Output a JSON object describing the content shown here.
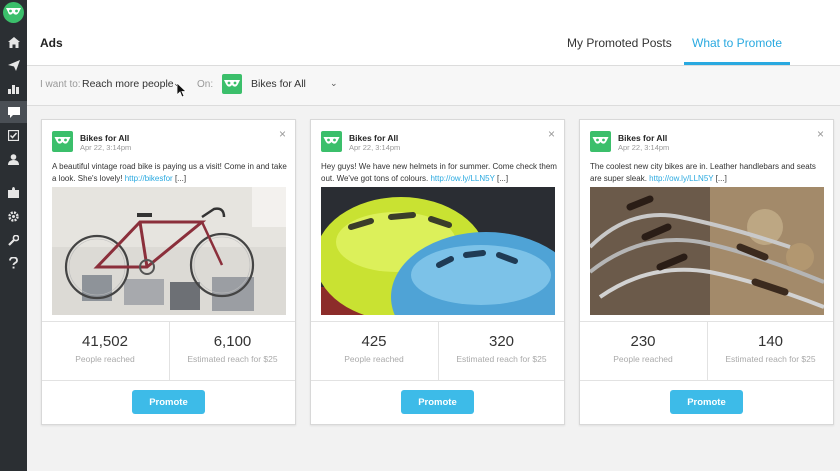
{
  "sidebar": {
    "items": [
      {
        "icon": "home-icon"
      },
      {
        "icon": "send-icon"
      },
      {
        "icon": "analytics-icon"
      },
      {
        "icon": "ads-icon"
      },
      {
        "icon": "assignments-icon"
      },
      {
        "icon": "contacts-icon"
      },
      {
        "icon": "apps-icon"
      },
      {
        "icon": "settings-icon"
      },
      {
        "icon": "tools-icon"
      },
      {
        "icon": "help-icon"
      }
    ]
  },
  "header": {
    "title": "Ads",
    "tabs": [
      {
        "label": "My Promoted Posts",
        "active": false
      },
      {
        "label": "What to Promote",
        "active": true
      }
    ]
  },
  "filter": {
    "goal_label": "I want to:",
    "goal_value": "Reach more people",
    "on_label": "On:",
    "profile_value": "Bikes for All"
  },
  "colors": {
    "accent": "#29a9e0",
    "button": "#3dbbe8",
    "brand_green": "#3bbf6b",
    "sidebar": "#2b2f33"
  },
  "cards": [
    {
      "author": "Bikes for All",
      "date": "Apr 22, 3:14pm",
      "text": "A beautiful vintage road bike is paying us a visit! Come in and take a look. She's lovely! ",
      "link": "http://bikesfor",
      "ellipsis": " [...]",
      "image": "vintage-road-bike-photo",
      "stat1_value": "41,502",
      "stat1_label": "People reached",
      "stat2_value": "6,100",
      "stat2_label": "Estimated reach for $25",
      "button": "Promote"
    },
    {
      "author": "Bikes for All",
      "date": "Apr 22, 3:14pm",
      "text": "Hey guys! We have new helmets in for summer. Come check them out. We've got tons of colours. ",
      "link": "http://ow.ly/LLN5Y",
      "ellipsis": " [...]",
      "image": "helmets-photo",
      "stat1_value": "425",
      "stat1_label": "People reached",
      "stat2_value": "320",
      "stat2_label": "Estimated reach for $25",
      "button": "Promote"
    },
    {
      "author": "Bikes for All",
      "date": "Apr 22, 3:14pm",
      "text": "The coolest new city bikes are in. Leather handlebars and seats are super sleak. ",
      "link": "http://ow.ly/LLN5Y",
      "ellipsis": " [...]",
      "image": "city-bikes-photo",
      "stat1_value": "230",
      "stat1_label": "People reached",
      "stat2_value": "140",
      "stat2_label": "Estimated reach for $25",
      "button": "Promote"
    }
  ]
}
